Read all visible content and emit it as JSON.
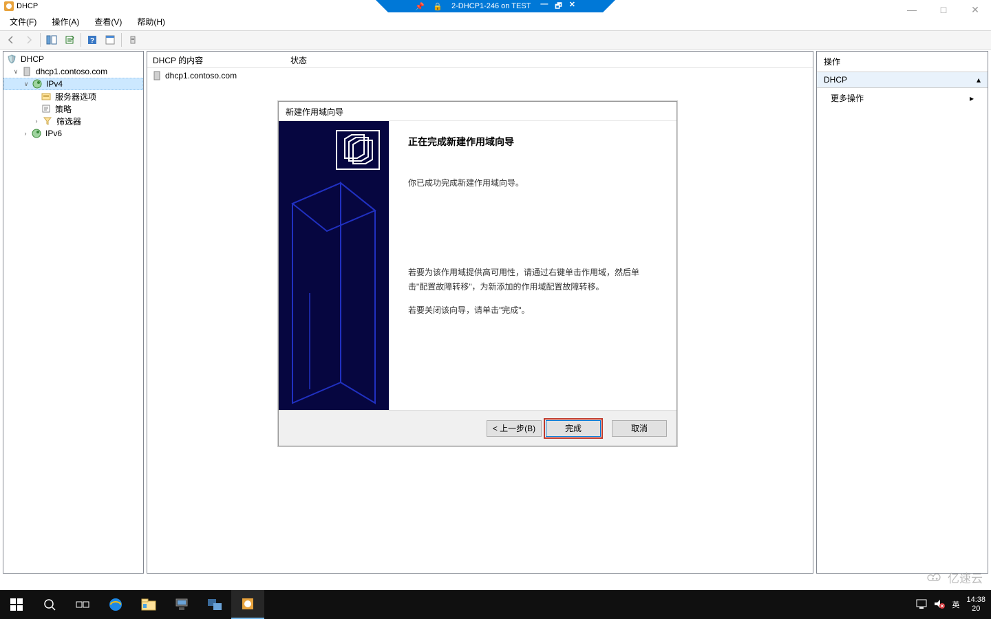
{
  "outer": {
    "minimize": "—",
    "maximize": "□",
    "close": "✕"
  },
  "vm_title": "2-DHCP1-246 on TEST",
  "vm_controls": {
    "minimize": "—",
    "restore": "🗗",
    "close": "✕"
  },
  "mmc_title": "DHCP",
  "menubar": {
    "file": "文件(F)",
    "action": "操作(A)",
    "view": "查看(V)",
    "help": "帮助(H)"
  },
  "tree": {
    "root": "DHCP",
    "server": "dhcp1.contoso.com",
    "ipv4": "IPv4",
    "server_options": "服务器选项",
    "policies": "策略",
    "filters": "筛选器",
    "ipv6": "IPv6"
  },
  "content": {
    "col_name": "DHCP 的内容",
    "col_state": "状态",
    "item1": "dhcp1.contoso.com"
  },
  "actions": {
    "title": "操作",
    "section": "DHCP",
    "more": "更多操作"
  },
  "wizard": {
    "title": "新建作用域向导",
    "heading": "正在完成新建作用域向导",
    "line1": "你已成功完成新建作用域向导。",
    "line2": "若要为该作用域提供高可用性，请通过右键单击作用域，然后单击\"配置故障转移\"，为新添加的作用域配置故障转移。",
    "line3": "若要关闭该向导，请单击\"完成\"。",
    "back": "< 上一步(B)",
    "finish": "完成",
    "cancel": "取消"
  },
  "tray": {
    "ime": "英",
    "year": "20",
    "time": "14:38"
  },
  "watermark": "亿速云"
}
